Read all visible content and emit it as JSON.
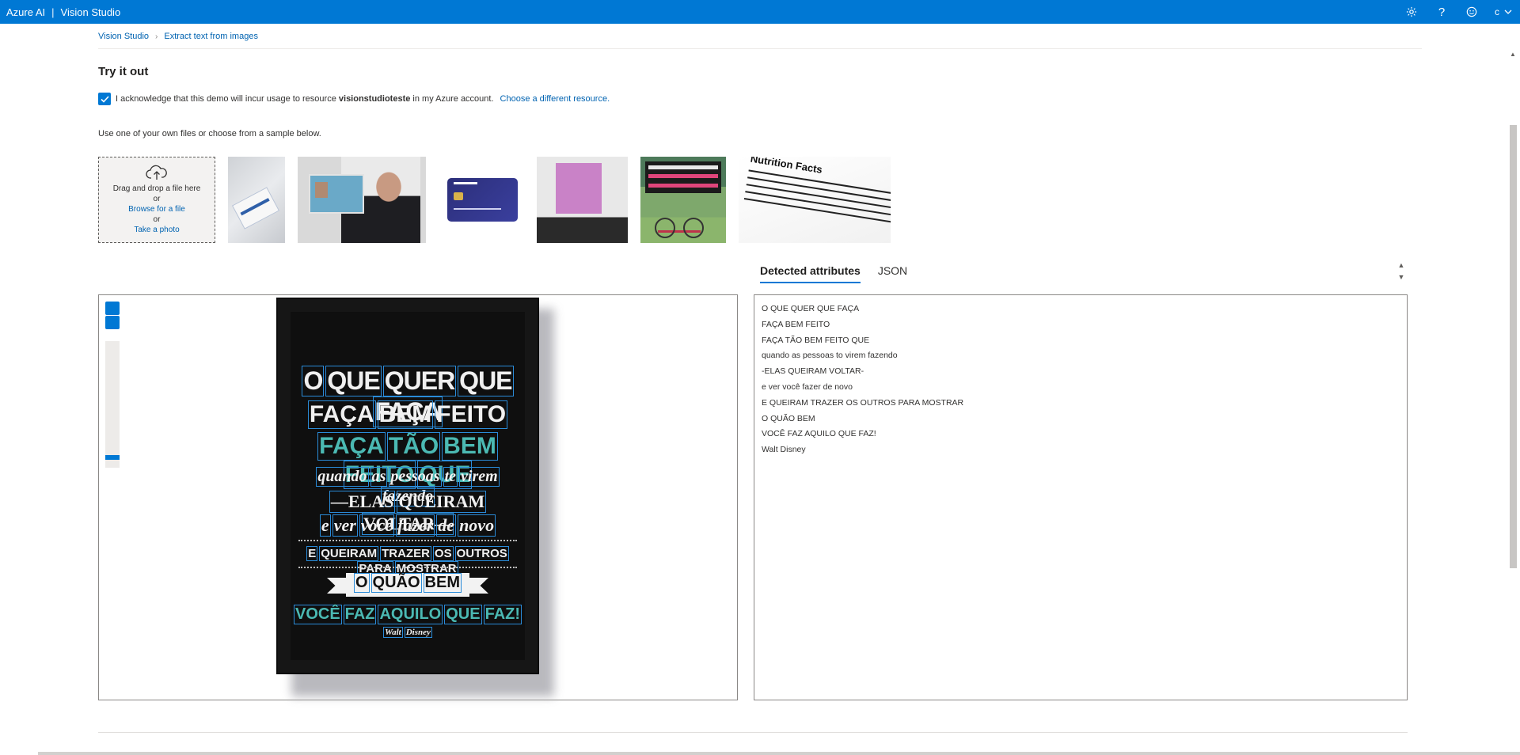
{
  "header": {
    "brand_left": "Azure AI",
    "brand_sep": "|",
    "brand_right": "Vision Studio",
    "user_initial": "c",
    "icons": [
      "gear-icon",
      "help-icon",
      "feedback-smiley-icon",
      "chevron-down-icon"
    ],
    "accent_color": "#0078d4"
  },
  "breadcrumb": {
    "home": "Vision Studio",
    "current": "Extract text from images"
  },
  "section": {
    "title": "Try it out"
  },
  "acknowledge": {
    "checked": true,
    "text_before": "I acknowledge that this demo will incur usage to resource",
    "resource": "visionstudioteste",
    "text_after": "in my Azure account.",
    "link": "Choose a different resource."
  },
  "upload": {
    "instruction": "Use one of your own files or choose from a sample below.",
    "drag_text": "Drag and drop a file here",
    "or1": "or",
    "browse": "Browse for a file",
    "or2": "or",
    "photo": "Take a photo"
  },
  "samples": {
    "t3_brand": "CreditCard",
    "t6_title": "Nutrition Facts"
  },
  "results": {
    "tabs": [
      "Detected attributes",
      "JSON"
    ],
    "active_tab": "Detected attributes",
    "lines": [
      "O QUE QUER QUE FAÇA",
      "FAÇA BEM FEITO",
      "FAÇA TÃO BEM FEITO QUE",
      "quando as pessoas to virem fazendo",
      "-ELAS QUEIRAM VOLTAR-",
      "e ver você fazer de novo",
      "E QUEIRAM TRAZER OS OUTROS PARA MOSTRAR",
      "O QUÃO BEM",
      "VOCÊ FAZ AQUILO QUE FAZ!",
      "Walt Disney"
    ]
  },
  "poster": {
    "l1": [
      "O",
      "QUE",
      "QUER",
      "QUE",
      "FAÇA"
    ],
    "l2": [
      "FAÇA",
      "BEM",
      "FEITO"
    ],
    "l3": [
      "FAÇA",
      "TÃO",
      "BEM",
      "FEITO",
      "QUE"
    ],
    "l4": [
      "quando",
      "as",
      "pessoas",
      "te",
      "virem",
      "fazendo"
    ],
    "l5": [
      "—ELAS",
      "QUEIRAM",
      "VOLTAR—"
    ],
    "l6": [
      "e",
      "ver",
      "você",
      "fazer",
      "de",
      "novo"
    ],
    "l7": [
      "E",
      "QUEIRAM",
      "TRAZER",
      "OS",
      "OUTROS",
      "PARA",
      "MOSTRAR"
    ],
    "l8": [
      "O",
      "QUÃO",
      "BEM"
    ],
    "l9": [
      "VOCÊ",
      "FAZ",
      "AQUILO",
      "QUE",
      "FAZ!"
    ],
    "l10": [
      "Walt",
      "Disney"
    ]
  }
}
